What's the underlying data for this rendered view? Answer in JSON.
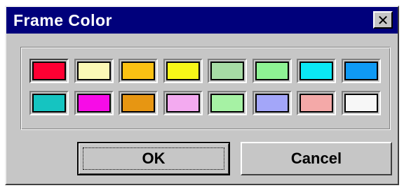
{
  "window": {
    "title": "Frame Color",
    "close_glyph": "✕"
  },
  "palette": {
    "selected_index": 0,
    "rows": [
      [
        {
          "name": "red",
          "color": "#ff0033"
        },
        {
          "name": "pale-yellow",
          "color": "#fbf8b6"
        },
        {
          "name": "orange",
          "color": "#fbc113"
        },
        {
          "name": "yellow",
          "color": "#f7f718"
        },
        {
          "name": "sage-green",
          "color": "#a7dca5"
        },
        {
          "name": "light-green",
          "color": "#8ef294"
        },
        {
          "name": "cyan",
          "color": "#0be8f4"
        },
        {
          "name": "azure",
          "color": "#0f9af4"
        }
      ],
      [
        {
          "name": "teal",
          "color": "#15c4c1"
        },
        {
          "name": "magenta",
          "color": "#f70ce7"
        },
        {
          "name": "amber",
          "color": "#e79612"
        },
        {
          "name": "pink",
          "color": "#f3aaf0"
        },
        {
          "name": "mint",
          "color": "#a6f2a4"
        },
        {
          "name": "lavender",
          "color": "#a3a6f9"
        },
        {
          "name": "salmon",
          "color": "#f4a9a8"
        },
        {
          "name": "white",
          "color": "#f7f7f7"
        }
      ]
    ]
  },
  "buttons": {
    "ok_label": "OK",
    "cancel_label": "Cancel"
  }
}
